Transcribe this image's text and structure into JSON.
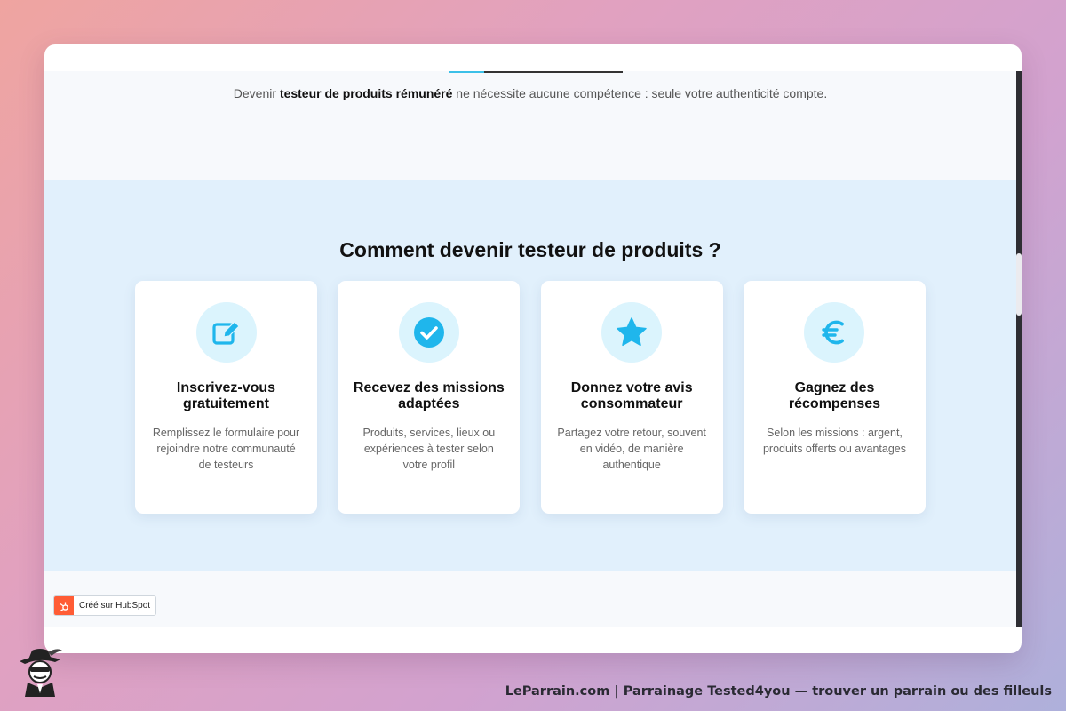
{
  "intro": {
    "prefix": "Devenir ",
    "bold": "testeur de produits rémunéré",
    "suffix": " ne nécessite aucune compétence : seule votre authenticité compte."
  },
  "how": {
    "title": "Comment devenir testeur de produits ?",
    "cards": [
      {
        "icon": "edit-icon",
        "title": "Inscrivez-vous gratuitement",
        "desc": "Remplissez le formulaire pour rejoindre notre communauté de testeurs"
      },
      {
        "icon": "check-circle-icon",
        "title": "Recevez des missions adaptées",
        "desc": "Produits, services, lieux ou expériences à tester selon votre profil"
      },
      {
        "icon": "star-icon",
        "title": "Donnez votre avis consommateur",
        "desc": "Partagez votre retour, souvent en vidéo, de manière authentique"
      },
      {
        "icon": "euro-icon",
        "title": "Gagnez des récompenses",
        "desc": "Selon les missions : argent, produits offerts ou avantages"
      }
    ]
  },
  "hubspot": {
    "label": "Créé sur HubSpot"
  },
  "footer": {
    "text": "LeParrain.com | Parrainage Tested4you — trouver un parrain ou des filleuls"
  },
  "colors": {
    "accent": "#1fb6ec",
    "icon_bg": "#dbf4fd",
    "section_bg": "#e1f0fc",
    "hubspot": "#ff5c35"
  }
}
